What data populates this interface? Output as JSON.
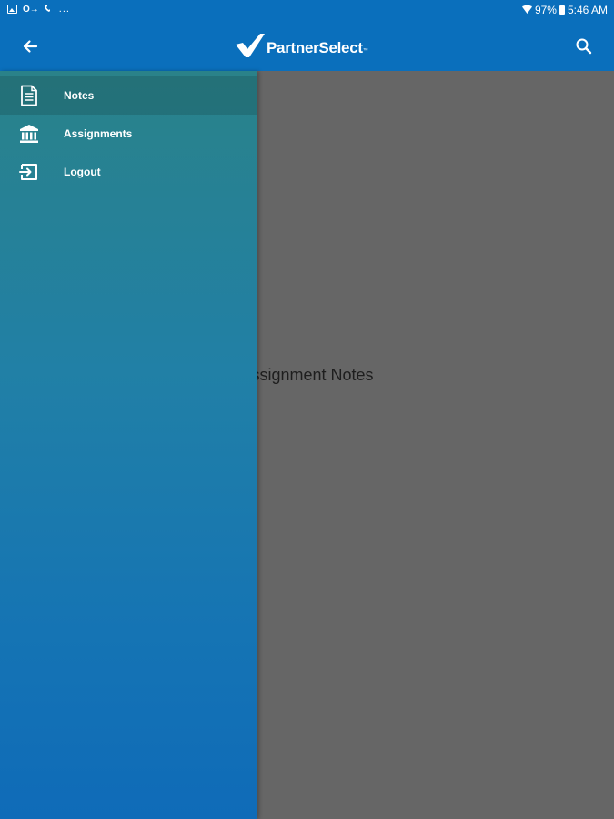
{
  "status_bar": {
    "key_label": "O→",
    "dots": "...",
    "battery": "97%",
    "time": "5:46 AM"
  },
  "app_bar": {
    "logo_text": "PartnerSelect",
    "logo_tm": "™",
    "back_icon": "arrow-left-icon",
    "search_icon": "search-icon"
  },
  "main": {
    "center_text": "Assignment Notes"
  },
  "drawer": {
    "items": [
      {
        "label": "Notes",
        "icon": "document-icon",
        "active": true
      },
      {
        "label": "Assignments",
        "icon": "bank-icon",
        "active": false
      },
      {
        "label": "Logout",
        "icon": "logout-icon",
        "active": false
      }
    ]
  },
  "colors": {
    "app_bar": "#0a6fbc",
    "drawer_top": "#2a8289",
    "drawer_bottom": "#0f6bb8",
    "scrim": "#666666"
  }
}
